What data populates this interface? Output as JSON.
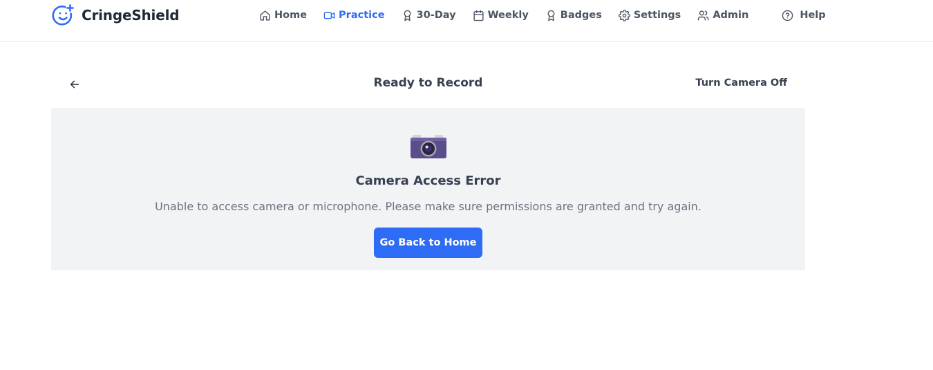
{
  "app": {
    "name": "CringeShield",
    "logo_icon": "smiley-plus-icon",
    "accent_color": "#2f6cf6"
  },
  "nav": {
    "items": [
      {
        "label": "Home",
        "icon": "home-icon"
      },
      {
        "label": "Practice",
        "icon": "video-camera-icon",
        "active": true
      },
      {
        "label": "30-Day",
        "icon": "award-ribbon-icon"
      },
      {
        "label": "Weekly",
        "icon": "calendar-icon"
      },
      {
        "label": "Badges",
        "icon": "badge-ribbon-icon"
      },
      {
        "label": "Settings",
        "icon": "gear-icon"
      },
      {
        "label": "Admin",
        "icon": "users-icon"
      }
    ],
    "help": {
      "label": "Help",
      "icon": "help-circle-icon"
    }
  },
  "recorder": {
    "title": "Ready to Record",
    "back_icon": "arrow-left-icon",
    "camera_toggle_label": "Turn Camera Off"
  },
  "error": {
    "icon": "camera-icon",
    "title": "Camera Access Error",
    "message": "Unable to access camera or microphone. Please make sure permissions are granted and try again.",
    "button_label": "Go Back to Home"
  }
}
